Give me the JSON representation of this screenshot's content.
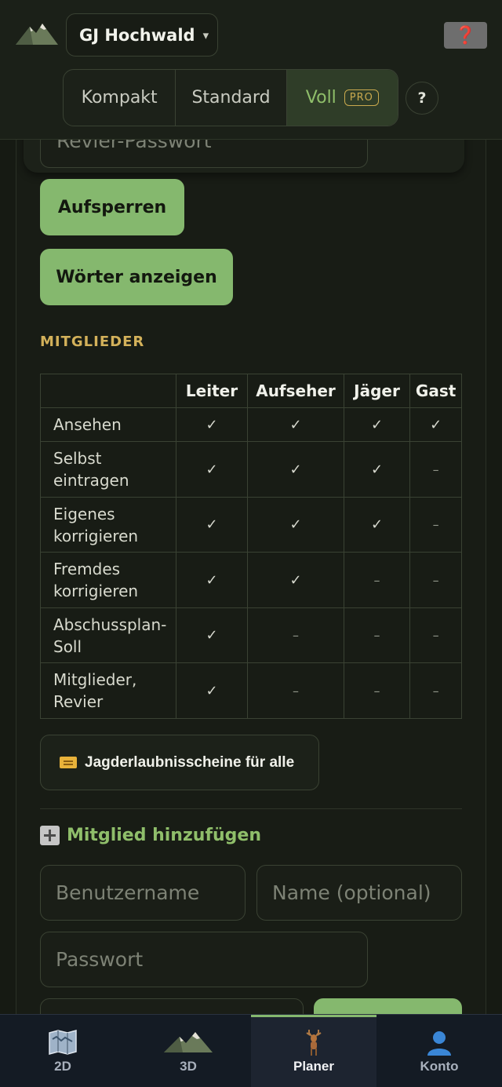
{
  "header": {
    "revier_name": "GJ Hochwald",
    "revier_caret": "▾",
    "help_red_label": "❓",
    "modes": [
      {
        "label": "Kompakt",
        "active": false
      },
      {
        "label": "Standard",
        "active": false
      },
      {
        "label": "Voll",
        "active": true,
        "badge": "PRO"
      }
    ],
    "help_label": "?"
  },
  "unlock_card": {
    "password_placeholder": "Revier-Passwort",
    "unlock_button": "Aufsperren",
    "words_button": "Wörter anzeigen"
  },
  "members": {
    "section_title": "MITGLIEDER",
    "table": {
      "columns": [
        "",
        "Leiter",
        "Aufseher",
        "Jäger",
        "Gast"
      ],
      "rows": [
        {
          "label_line1": "Ansehen",
          "label_line2": "",
          "values": [
            "✓",
            "✓",
            "✓",
            "✓"
          ]
        },
        {
          "label_line1": "Selbst",
          "label_line2": "eintragen",
          "values": [
            "✓",
            "✓",
            "✓",
            "–"
          ]
        },
        {
          "label_line1": "Eigenes",
          "label_line2": "korrigieren",
          "values": [
            "✓",
            "✓",
            "✓",
            "–"
          ]
        },
        {
          "label_line1": "Fremdes",
          "label_line2": "korrigieren",
          "values": [
            "✓",
            "✓",
            "–",
            "–"
          ]
        },
        {
          "label_line1": "Abschussplan-",
          "label_line2": "Soll",
          "values": [
            "✓",
            "–",
            "–",
            "–"
          ]
        },
        {
          "label_line1": "Mitglieder,",
          "label_line2": "Revier",
          "values": [
            "✓",
            "–",
            "–",
            "–"
          ]
        }
      ]
    },
    "license_button": "Jagderlaubnisscheine für alle",
    "add_member_title": "Mitglied hinzufügen",
    "username_placeholder": "Benutzername",
    "name_placeholder": "Name (optional)",
    "password_placeholder": "Passwort"
  },
  "bottom_nav": [
    {
      "label": "2D",
      "icon": "map-icon",
      "active": false
    },
    {
      "label": "3D",
      "icon": "mountain-icon",
      "active": false
    },
    {
      "label": "Planer",
      "icon": "deer-icon",
      "active": true
    },
    {
      "label": "Konto",
      "icon": "user-icon",
      "active": false
    }
  ],
  "colors": {
    "accent_green": "#85b86e",
    "section_gold": "#d3b15a",
    "background": "#161a13"
  }
}
